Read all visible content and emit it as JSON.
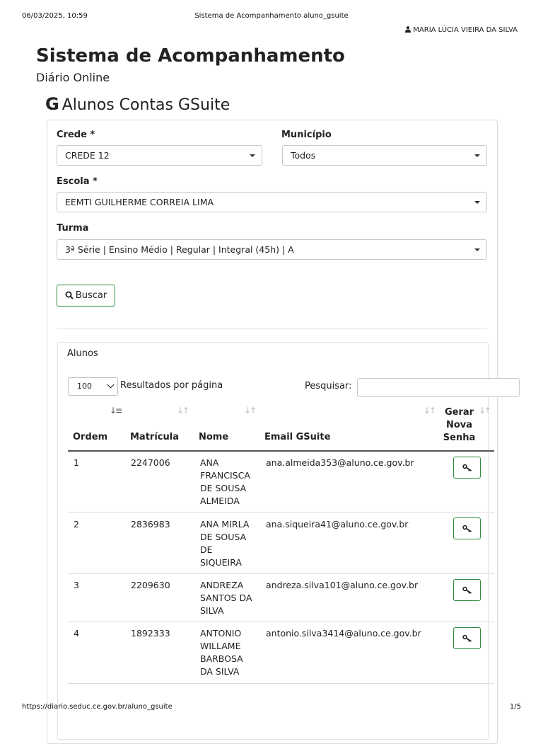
{
  "print_header": {
    "datetime": "06/03/2025, 10:59",
    "doc_title": "Sistema de Acompanhamento aluno_gsuite"
  },
  "print_footer": {
    "url": "https://diario.seduc.ce.gov.br/aluno_gsuite",
    "page": "1/5"
  },
  "user": {
    "name": "MARIA LÚCIA VIEIRA DA SILVA",
    "icon": "user-icon"
  },
  "app": {
    "title": "Sistema de Acompanhamento",
    "subtitle": "Diário Online"
  },
  "page": {
    "logo_letter": "G",
    "heading": "Alunos Contas GSuite"
  },
  "filters": {
    "crede_label": "Crede *",
    "crede_value": "CREDE 12",
    "municipio_label": "Município",
    "municipio_value": "Todos",
    "escola_label": "Escola *",
    "escola_value": "EEMTI GUILHERME CORREIA LIMA",
    "turma_label": "Turma",
    "turma_value": "3ª Série | Ensino Médio | Regular | Integral (45h) | A",
    "search_button": "Buscar"
  },
  "alunos": {
    "title": "Alunos",
    "page_size": "100",
    "page_size_label": "Resultados por página",
    "search_label": "Pesquisar:",
    "search_value": "",
    "columns": {
      "ordem": "Ordem",
      "matricula": "Matrícula",
      "nome": "Nome",
      "email": "Email GSuite",
      "gerar": "Gerar Nova Senha"
    },
    "rows": [
      {
        "ordem": "1",
        "matricula": "2247006",
        "nome": "ANA FRANCISCA DE SOUSA ALMEIDA",
        "email": "ana.almeida353@aluno.ce.gov.br"
      },
      {
        "ordem": "2",
        "matricula": "2836983",
        "nome": "ANA MIRLA DE SOUSA DE SIQUEIRA",
        "email": "ana.siqueira41@aluno.ce.gov.br"
      },
      {
        "ordem": "3",
        "matricula": "2209630",
        "nome": "ANDREZA SANTOS DA SILVA",
        "email": "andreza.silva101@aluno.ce.gov.br"
      },
      {
        "ordem": "4",
        "matricula": "1892333",
        "nome": "ANTONIO WILLAME BARBOSA DA SILVA",
        "email": "antonio.silva3414@aluno.ce.gov.br"
      }
    ]
  },
  "colors": {
    "accent_green": "#2e8b3a",
    "border": "#d9d9d9"
  }
}
